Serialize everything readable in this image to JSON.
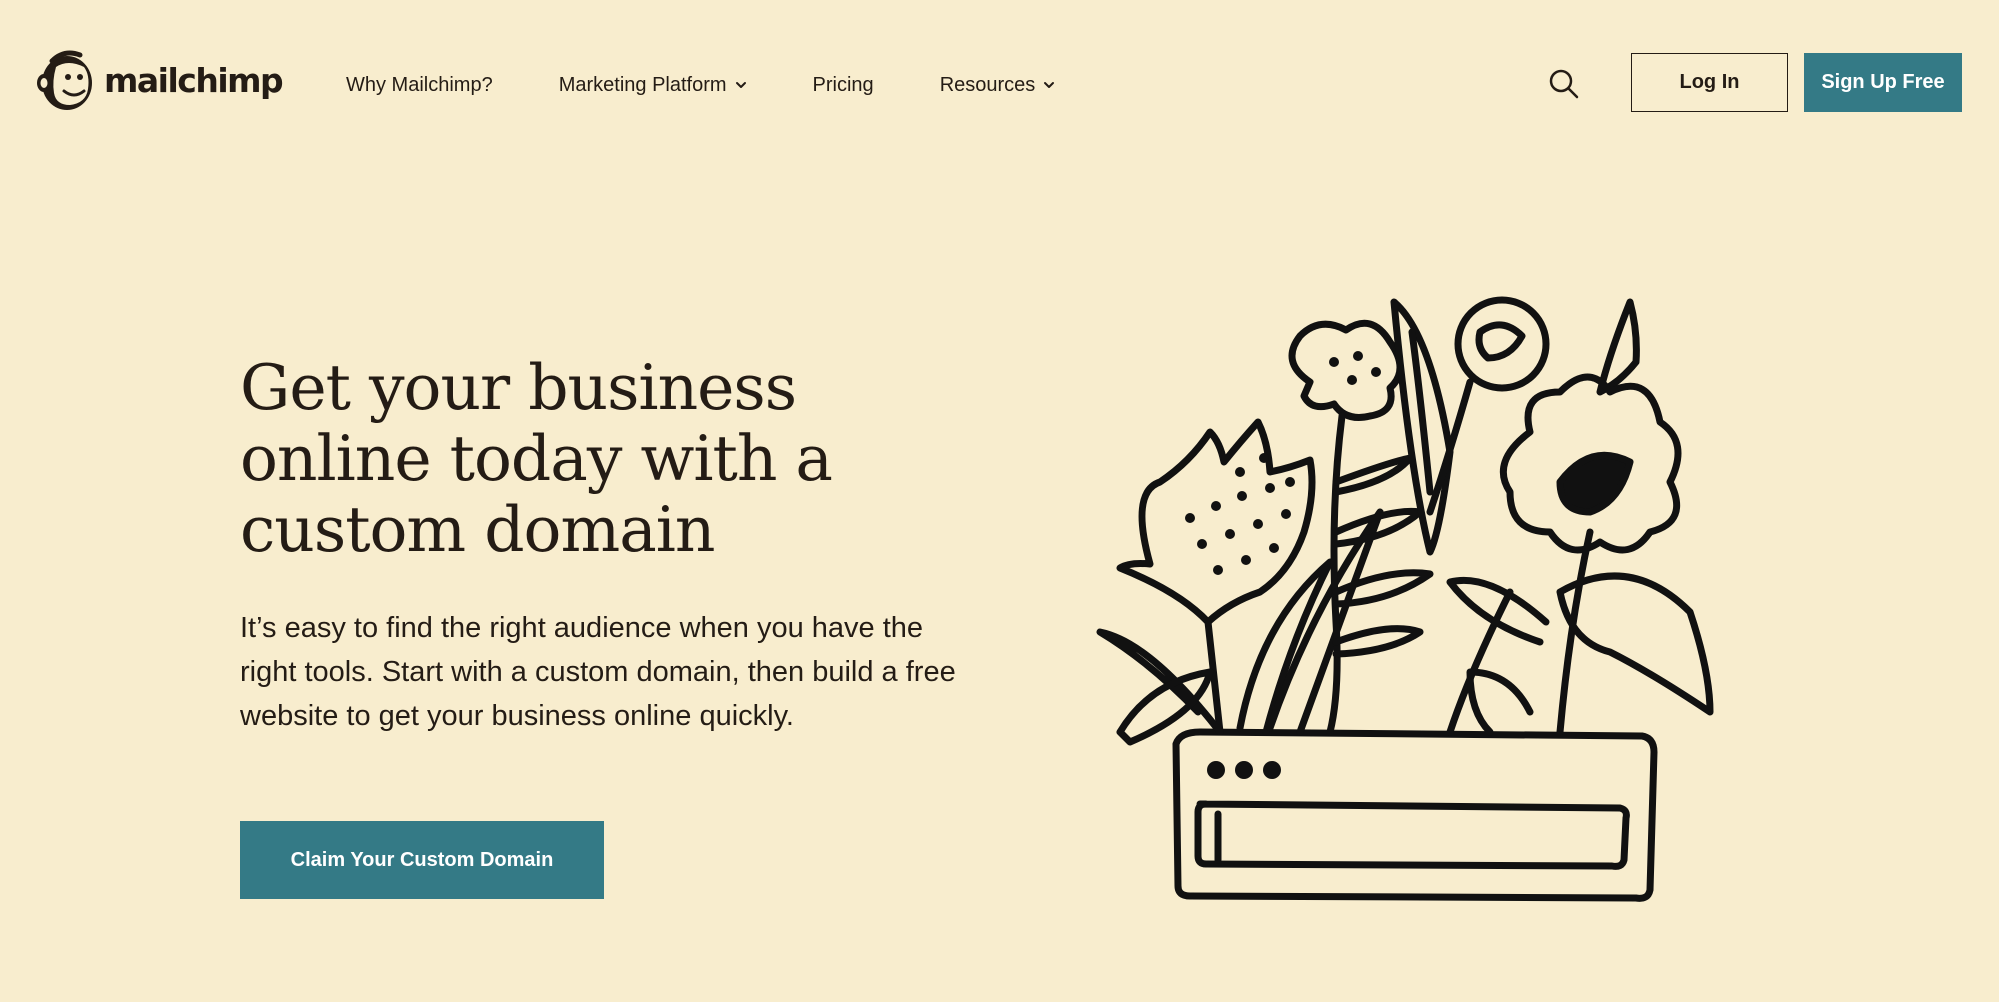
{
  "brand": {
    "name": "mailchimp",
    "accent_color": "#347A86",
    "background_color": "#F8EDCE",
    "text_color": "#241C15"
  },
  "header": {
    "nav": [
      {
        "label": "Why Mailchimp?",
        "has_dropdown": false
      },
      {
        "label": "Marketing Platform",
        "has_dropdown": true
      },
      {
        "label": "Pricing",
        "has_dropdown": false
      },
      {
        "label": "Resources",
        "has_dropdown": true
      }
    ],
    "search_icon": "search-icon",
    "login_label": "Log In",
    "signup_label": "Sign Up Free"
  },
  "hero": {
    "title": "Get your business online today with a custom domain",
    "body": "It’s easy to find the right audience when you have the right tools. Start with a custom domain, then build a free website to get your business online quickly.",
    "cta_label": "Claim Your Custom Domain",
    "illustration": "flowers-in-browser-planter-illustration"
  }
}
